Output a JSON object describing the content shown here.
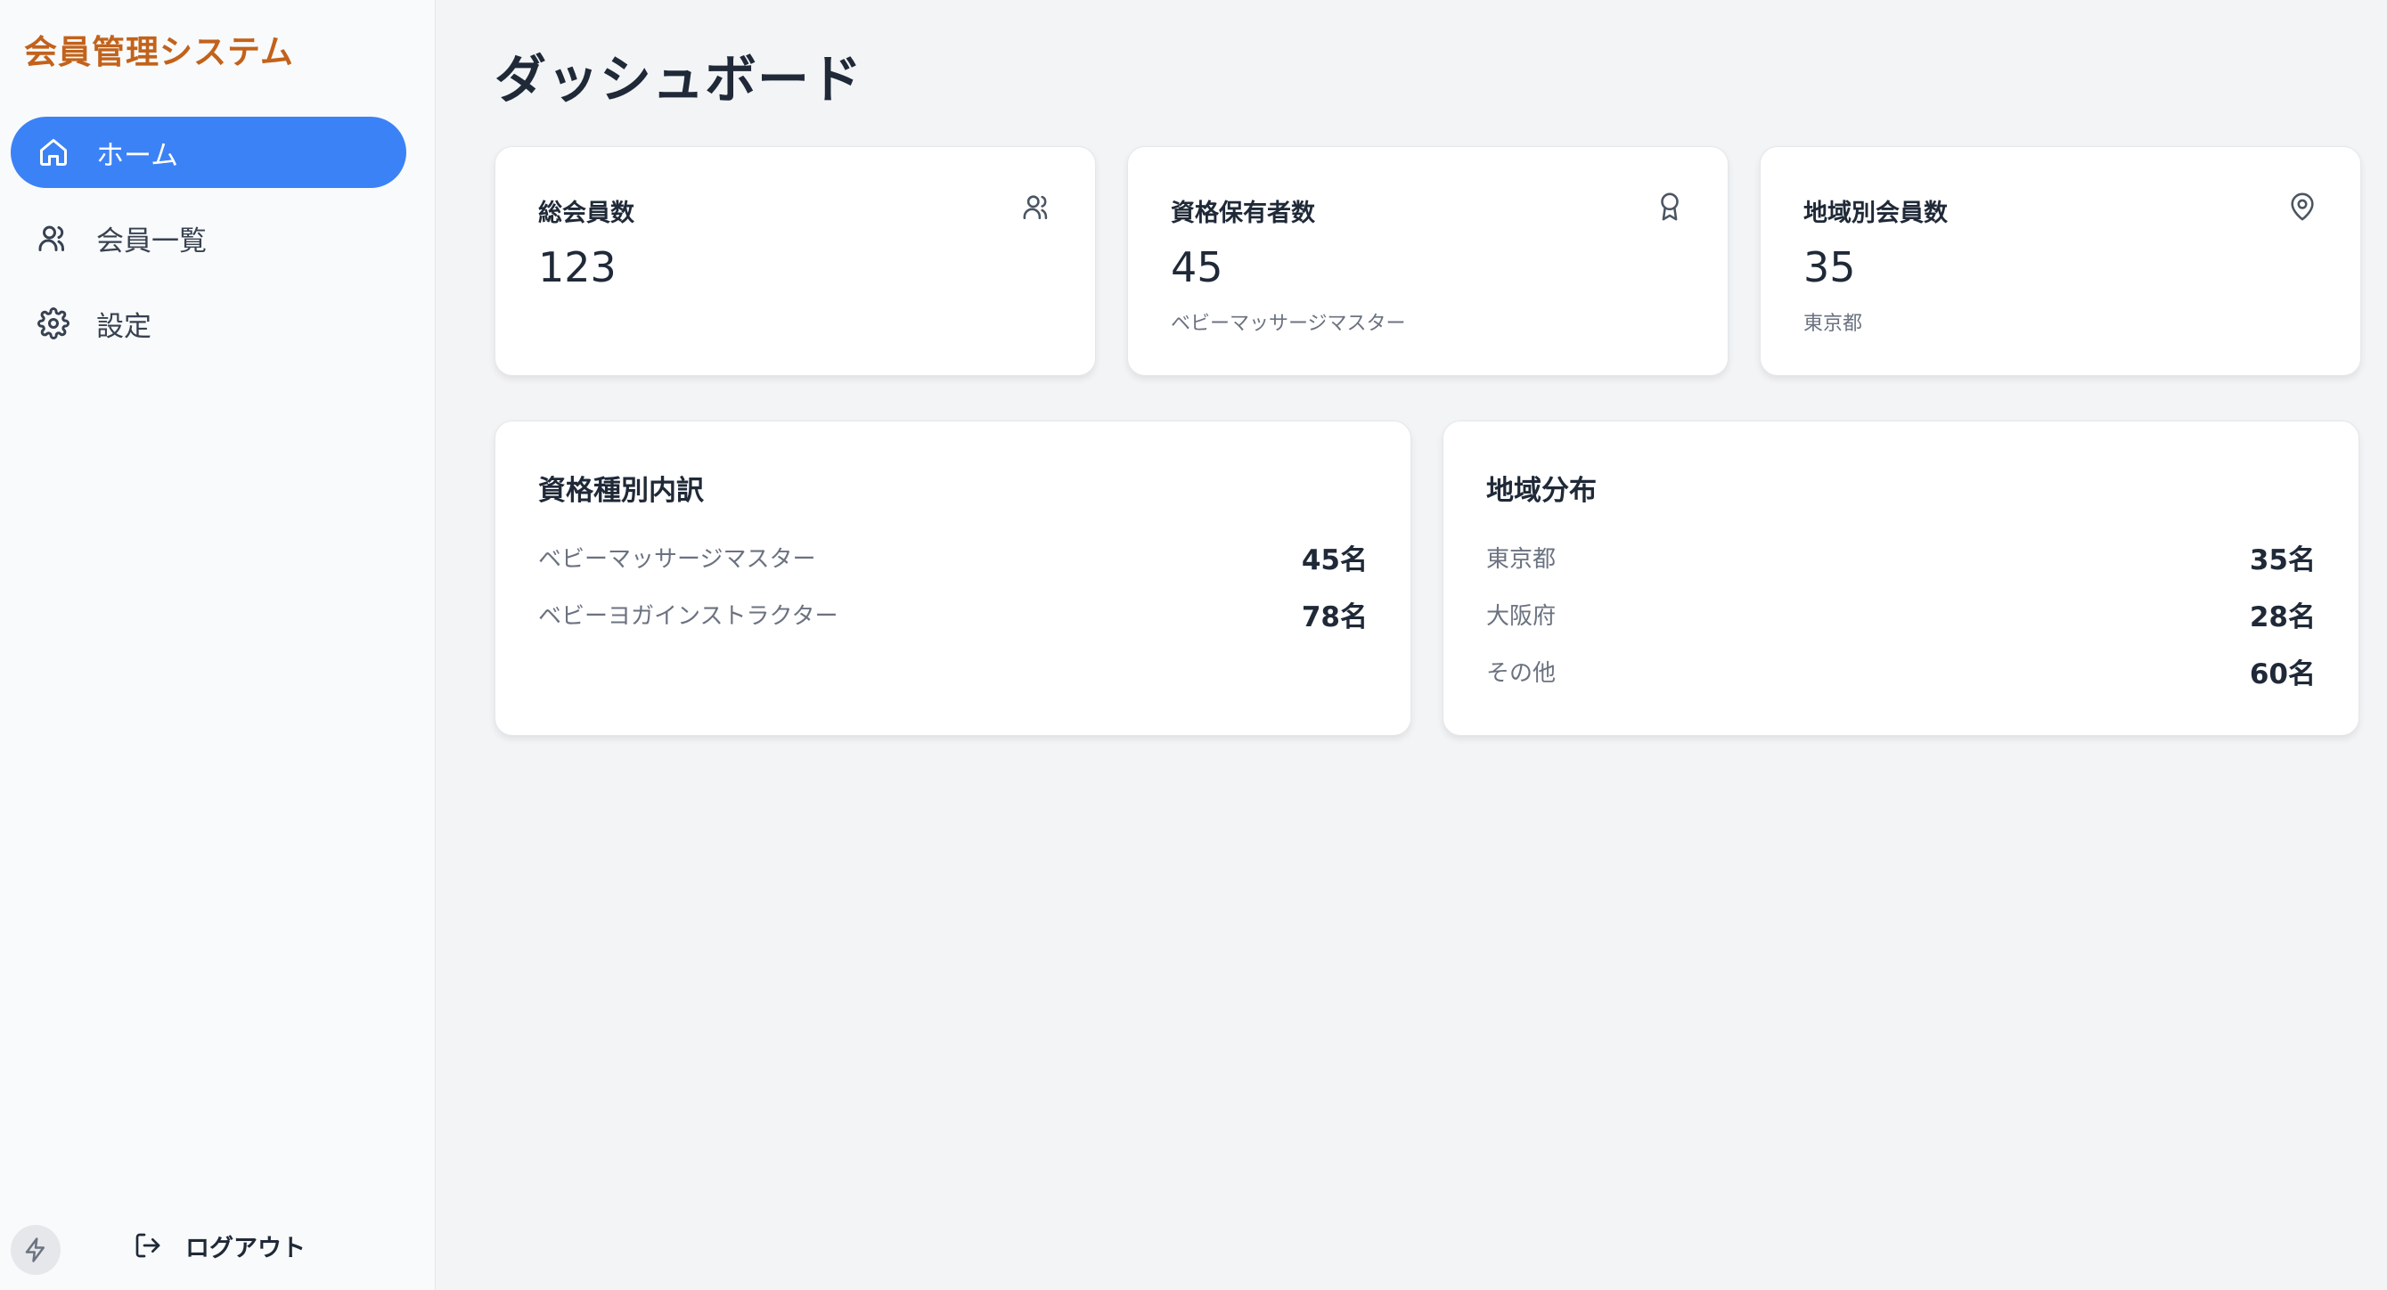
{
  "sidebar": {
    "brand": "会員管理システム",
    "items": [
      {
        "label": "ホーム",
        "icon": "home-icon",
        "active": true
      },
      {
        "label": "会員一覧",
        "icon": "users-icon",
        "active": false
      },
      {
        "label": "設定",
        "icon": "gear-icon",
        "active": false
      }
    ],
    "logout_label": "ログアウト"
  },
  "main": {
    "title": "ダッシュボード",
    "stats": [
      {
        "title": "総会員数",
        "value": "123",
        "sub": "",
        "icon": "users-icon"
      },
      {
        "title": "資格保有者数",
        "value": "45",
        "sub": "ベビーマッサージマスター",
        "icon": "award-icon"
      },
      {
        "title": "地域別会員数",
        "value": "35",
        "sub": "東京都",
        "icon": "map-pin-icon"
      }
    ],
    "qualifications": {
      "title": "資格種別内訳",
      "rows": [
        {
          "label": "ベビーマッサージマスター",
          "value": "45名"
        },
        {
          "label": "ベビーヨガインストラクター",
          "value": "78名"
        }
      ]
    },
    "regions": {
      "title": "地域分布",
      "rows": [
        {
          "label": "東京都",
          "value": "35名"
        },
        {
          "label": "大阪府",
          "value": "28名"
        },
        {
          "label": "その他",
          "value": "60名"
        }
      ]
    }
  },
  "colors": {
    "accent": "#3b82f6",
    "brand": "#c2621b",
    "background": "#f3f4f6"
  }
}
